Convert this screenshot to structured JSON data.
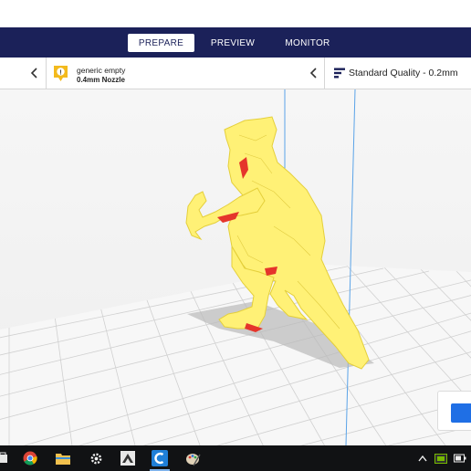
{
  "header": {
    "tabs": [
      {
        "label": "PREPARE",
        "active": true
      },
      {
        "label": "PREVIEW",
        "active": false
      },
      {
        "label": "MONITOR",
        "active": false
      }
    ],
    "colors": {
      "bar": "#1b2159",
      "active_tab_bg": "#ffffff"
    }
  },
  "stage_bar": {
    "printer": {
      "name": "generic empty",
      "nozzle": "0.4mm Nozzle",
      "badge_icon": "warning-badge-icon",
      "badge_text": "!"
    },
    "quality": {
      "label": "Standard Quality - 0.2mm",
      "icon": "layers-icon"
    }
  },
  "viewport": {
    "object": "dinosaur-model",
    "colors": {
      "model": "#fff176",
      "overhang": "#e5352b",
      "plate": "#f7f7f7",
      "grid": "#cfcfcf",
      "axis": "#5aa3e8"
    }
  },
  "action_panel": {
    "button_color": "#1f6fe5"
  },
  "taskbar": {
    "apps": [
      {
        "name": "store-icon"
      },
      {
        "name": "chrome-icon"
      },
      {
        "name": "file-explorer-icon"
      },
      {
        "name": "settings-icon"
      },
      {
        "name": "zbrush-icon"
      },
      {
        "name": "cura-icon",
        "active": true
      },
      {
        "name": "paint-icon"
      }
    ],
    "tray": [
      "chevron-up-icon",
      "gpu-icon",
      "battery-icon"
    ]
  }
}
